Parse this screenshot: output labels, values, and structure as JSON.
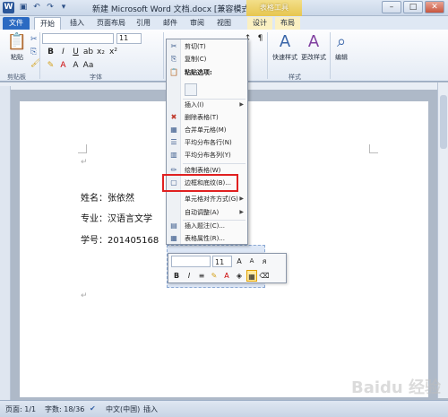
{
  "titlebar": {
    "title": "新建 Microsoft Word 文档.docx [兼容模式] - Micros...",
    "context_tab_title": "表格工具"
  },
  "tabs": [
    "文件",
    "开始",
    "插入",
    "页面布局",
    "引用",
    "邮件",
    "审阅",
    "视图",
    "设计",
    "布局"
  ],
  "ribbon": {
    "paste_label": "粘贴",
    "clipboard_label": "剪贴板",
    "font_label": "字体",
    "font_size": "11",
    "styles_label": "样式",
    "quick_styles_label": "快速样式",
    "change_styles_label": "更改样式",
    "edit_label": "编辑"
  },
  "document": {
    "line1": "姓名：张依然",
    "line2": "专业：汉语言文学",
    "line3": "学号：201405168",
    "para_mark": "↵"
  },
  "context_menu": {
    "items": [
      {
        "label": "剪切(T)",
        "icon": "scissors-icon"
      },
      {
        "label": "复制(C)",
        "icon": "copy-icon"
      },
      {
        "label": "粘贴选项:",
        "icon": "paste-icon"
      },
      {
        "label": "插入(I)",
        "icon": "",
        "submenu": true
      },
      {
        "label": "删除表格(T)",
        "icon": "delete-table-icon"
      },
      {
        "label": "合并单元格(M)",
        "icon": "merge-cells-icon"
      },
      {
        "label": "平均分布各行(N)",
        "icon": "distribute-rows-icon"
      },
      {
        "label": "平均分布各列(Y)",
        "icon": "distribute-columns-icon"
      },
      {
        "label": "绘制表格(W)",
        "icon": "draw-table-icon"
      },
      {
        "label": "边框和底纹(B)...",
        "icon": "borders-icon"
      },
      {
        "label": "单元格对齐方式(G)",
        "icon": "",
        "submenu": true
      },
      {
        "label": "自动调整(A)",
        "icon": "",
        "submenu": true
      },
      {
        "label": "插入题注(C)...",
        "icon": "caption-icon"
      },
      {
        "label": "表格属性(R)...",
        "icon": "table-properties-icon"
      }
    ]
  },
  "mini_toolbar": {
    "font_size": "11"
  },
  "statusbar": {
    "page": "页面: 1/1",
    "words": "字数: 18/36",
    "language": "中文(中国)",
    "mode": "插入"
  },
  "watermark": "Baidu 经验"
}
